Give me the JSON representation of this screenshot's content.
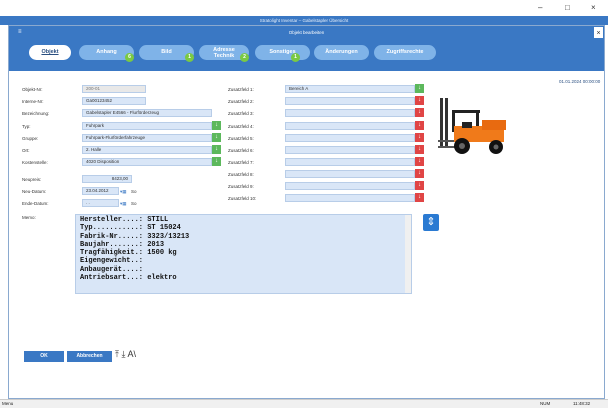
{
  "background_window": {
    "title": "Stratolight Inventar – Gabelstapler Übersicht"
  },
  "outer_controls": {
    "minimize": "–",
    "maximize": "□",
    "close": "×"
  },
  "modal": {
    "title": "Objekt bearbeiten",
    "close": "×",
    "menu_icon": "≡"
  },
  "tabs": [
    {
      "label": "Objekt",
      "badge": ""
    },
    {
      "label": "Anhang",
      "badge": "6"
    },
    {
      "label": "Bild",
      "badge": "1"
    },
    {
      "label_line1": "Adresse",
      "label_line2": "Technik",
      "badge": "2"
    },
    {
      "label": "Sonstiges",
      "badge": "1"
    },
    {
      "label": "Änderungen",
      "badge": ""
    },
    {
      "label": "Zugriffsrechte",
      "badge": ""
    }
  ],
  "timestamp": "01.01.2024 00:00:00",
  "fields": {
    "objekt_nr": {
      "label": "Objekt-Nr:",
      "value": "200-01"
    },
    "interne_nr": {
      "label": "Interne-Nr:",
      "value": "Ga00123452"
    },
    "bezeichnung": {
      "label": "Bezeichnung:",
      "value": "Gabelstapler E4566 - Flurförderzeug"
    },
    "typ": {
      "label": "Typ:",
      "value": "Fuhrpark"
    },
    "gruppe": {
      "label": "Gruppe:",
      "value": "Fuhrpark-Flurförderfahrzeuge"
    },
    "ort": {
      "label": "Ort:",
      "value": "2. Halle"
    },
    "kostenstelle": {
      "label": "Kostenstelle:",
      "value": "4020 Disposition"
    },
    "neupreis": {
      "label": "Neupreis:",
      "value": "8423,00"
    },
    "neu_datum": {
      "label": "Neu-Datum:",
      "value": "23.04.2012",
      "weekday": "So"
    },
    "ende_datum": {
      "label": "Ende-Datum:",
      "value": ". .",
      "weekday": "So"
    },
    "memo": {
      "label": "Memo:"
    }
  },
  "zusatz": [
    {
      "label": "Zusatzfeld 1:",
      "value": "Bereich A",
      "arrow": "green"
    },
    {
      "label": "Zusatzfeld 2:",
      "value": "",
      "arrow": "red"
    },
    {
      "label": "Zusatzfeld 3:",
      "value": "",
      "arrow": "red"
    },
    {
      "label": "Zusatzfeld 4:",
      "value": "",
      "arrow": "red"
    },
    {
      "label": "Zusatzfeld 5:",
      "value": "",
      "arrow": "red"
    },
    {
      "label": "Zusatzfeld 6:",
      "value": "",
      "arrow": "red"
    },
    {
      "label": "Zusatzfeld 7:",
      "value": "",
      "arrow": "red"
    },
    {
      "label": "Zusatzfeld 8:",
      "value": "",
      "arrow": "red"
    },
    {
      "label": "Zusatzfeld 9:",
      "value": "",
      "arrow": "red"
    },
    {
      "label": "Zusatzfeld 10:",
      "value": "",
      "arrow": "red"
    }
  ],
  "memo_lines": [
    "Hersteller....: STILL",
    "Typ...........: ST 15024",
    "Fabrik-Nr.....: 3323/13213",
    "Baujahr.......: 2013",
    "Tragfähigkeit.: 1500 kg",
    "Eigengewicht..:",
    "Anbaugerät....:",
    "Antriebsart...: elektro"
  ],
  "buttons": {
    "ok": "OK",
    "cancel": "Abbrechen",
    "extra_icons": "⤒ ⤓ A\\"
  },
  "status_bar": {
    "left": "Menu",
    "num": "NUM",
    "time": "11:48:32"
  },
  "colors": {
    "accent": "#3a78c4",
    "tab_inactive": "#7fb3e8",
    "badge": "#7ac943",
    "field_bg": "#d9e6f7",
    "arrow_green": "#5cb85c",
    "arrow_red": "#e04545"
  }
}
